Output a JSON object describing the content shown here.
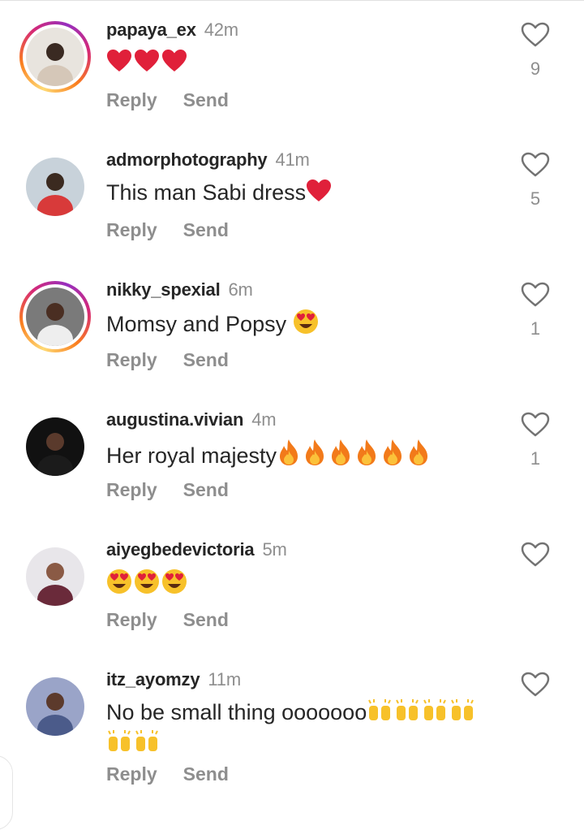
{
  "comments": [
    {
      "username": "papaya_ex",
      "time": "42m",
      "text": "",
      "emoji": [
        "heart",
        "heart",
        "heart"
      ],
      "likes": "9",
      "story_ring": true,
      "avatar_colors": [
        "#e8e4de",
        "#d5c7b8",
        "#3a2a22"
      ]
    },
    {
      "username": "admorphotography",
      "time": "41m",
      "text": "This man Sabi dress",
      "emoji": [
        "heart"
      ],
      "likes": "5",
      "story_ring": false,
      "avatar_colors": [
        "#c8d2da",
        "#d83a3a",
        "#3b2a20"
      ]
    },
    {
      "username": "nikky_spexial",
      "time": "6m",
      "text": "Momsy and Popsy ",
      "emoji": [
        "heart-eyes"
      ],
      "likes": "1",
      "story_ring": true,
      "avatar_colors": [
        "#7a7a7a",
        "#eeeeee",
        "#4a2e22"
      ]
    },
    {
      "username": "augustina.vivian",
      "time": "4m",
      "text": "Her royal majesty",
      "emoji": [
        "fire",
        "fire",
        "fire",
        "fire",
        "fire",
        "fire"
      ],
      "likes": "1",
      "story_ring": false,
      "avatar_colors": [
        "#111111",
        "#1b1b1b",
        "#5a3a2c"
      ]
    },
    {
      "username": "aiyegbedevictoria",
      "time": "5m",
      "text": "",
      "emoji": [
        "heart-eyes",
        "heart-eyes",
        "heart-eyes"
      ],
      "likes": "",
      "story_ring": false,
      "avatar_colors": [
        "#e8e6ea",
        "#6a2a3a",
        "#8a5a45"
      ]
    },
    {
      "username": "itz_ayomzy",
      "time": "11m",
      "text": "No be small thing ooooooo",
      "emoji": [
        "raising-hands",
        "raising-hands",
        "raising-hands",
        "raising-hands",
        "raising-hands",
        "raising-hands"
      ],
      "likes": "",
      "story_ring": false,
      "avatar_colors": [
        "#9aa4c8",
        "#4b5b8a",
        "#5c3a2c"
      ]
    }
  ],
  "labels": {
    "reply": "Reply",
    "send": "Send"
  },
  "colors": {
    "text": "#262626",
    "muted": "#8e8e8e",
    "heart": "#e0203a",
    "fire": "#f27a1a",
    "emoji_yellow": "#f7c12a"
  }
}
